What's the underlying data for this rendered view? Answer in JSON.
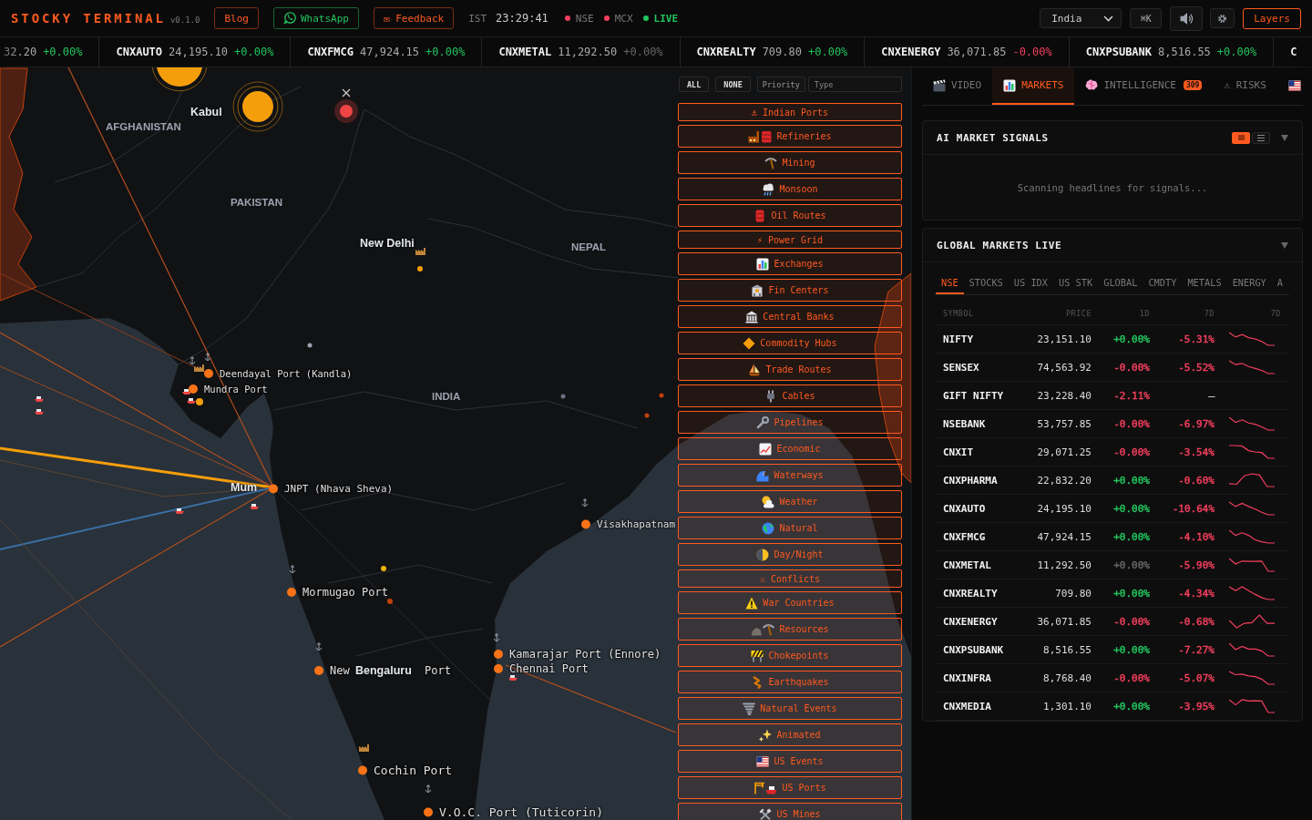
{
  "header": {
    "brand": "STOCKY TERMINAL",
    "version": "v0.1.0",
    "links": [
      {
        "label": "Blog",
        "kind": "plain"
      },
      {
        "label": "WhatsApp",
        "kind": "whatsapp"
      },
      {
        "label": "✉ Feedback",
        "kind": "plain"
      }
    ],
    "timezone": "IST",
    "time": "23:29:41",
    "status": [
      {
        "label": "NSE",
        "kind": "market",
        "color": "#f43f5e"
      },
      {
        "label": "MCX",
        "kind": "market",
        "color": "#f43f5e"
      },
      {
        "label": "LIVE",
        "kind": "live",
        "color": "#22c55e"
      }
    ],
    "region": "India",
    "shortcut": "⌘K",
    "layers_button": "Layers"
  },
  "ticker": [
    {
      "price": "32.20",
      "change": "+0.00%",
      "color": "#22c55e"
    },
    {
      "symbol": "CNXAUTO",
      "price": "24,195.10",
      "change": "+0.00%",
      "color": "#22c55e"
    },
    {
      "symbol": "CNXFMCG",
      "price": "47,924.15",
      "change": "+0.00%",
      "color": "#22c55e"
    },
    {
      "symbol": "CNXMETAL",
      "price": "11,292.50",
      "change": "+0.00%",
      "color": "#666666"
    },
    {
      "symbol": "CNXREALTY",
      "price": "709.80",
      "change": "+0.00%",
      "color": "#22c55e"
    },
    {
      "symbol": "CNXENERGY",
      "price": "36,071.85",
      "change": "-0.00%",
      "color": "#f43f5e"
    },
    {
      "symbol": "CNXPSUBANK",
      "price": "8,516.55",
      "change": "+0.00%",
      "color": "#22c55e"
    },
    {
      "symbol": "C"
    }
  ],
  "map": {
    "labels": [
      {
        "text": "AFGHANISTAN",
        "kind": "country"
      },
      {
        "text": "Kabul",
        "kind": "city"
      },
      {
        "text": "PAKISTAN",
        "kind": "country"
      },
      {
        "text": "New Delhi",
        "kind": "city"
      },
      {
        "text": "NEPAL",
        "kind": "country"
      },
      {
        "text": "INDIA",
        "kind": "country"
      },
      {
        "text": "Deendayal Port (Kandla)",
        "kind": "port"
      },
      {
        "text": "Mundra Port",
        "kind": "port"
      },
      {
        "text": "Mum",
        "kind": "city"
      },
      {
        "text": "JNPT (Nhava Sheva)",
        "kind": "port"
      },
      {
        "text": "Mormugao Port",
        "kind": "port"
      },
      {
        "text": "New",
        "kind": "port"
      },
      {
        "text": "Bengaluru",
        "kind": "city"
      },
      {
        "text": "Port",
        "kind": "text"
      },
      {
        "text": "Visakhapatnam",
        "kind": "port"
      },
      {
        "text": "Kamarajar Port (Ennore)",
        "kind": "port"
      },
      {
        "text": "Chennai Port",
        "kind": "port"
      },
      {
        "text": "Cochin Port",
        "kind": "port"
      },
      {
        "text": "V.O.C. Port (Tuticorin)",
        "kind": "port"
      }
    ]
  },
  "layer_panel": {
    "controls": [
      {
        "label": "ALL",
        "kind": "action"
      },
      {
        "label": "NONE",
        "kind": "action"
      },
      {
        "label": "Priority",
        "kind": "sort"
      }
    ],
    "type_filter": {
      "placeholder": "Type"
    },
    "layers": [
      {
        "label": "⚓ Indian Ports",
        "on": true
      },
      {
        "label": "Refineries",
        "on": true
      },
      {
        "label": "Mining",
        "on": true
      },
      {
        "label": "Monsoon",
        "on": true
      },
      {
        "label": "Oil Routes",
        "on": true
      },
      {
        "label": "⚡ Power Grid",
        "on": true
      },
      {
        "label": "Exchanges",
        "on": true
      },
      {
        "label": "Fin Centers",
        "on": true
      },
      {
        "label": "Central Banks",
        "on": true
      },
      {
        "label": "Commodity Hubs",
        "on": true
      },
      {
        "label": "Trade Routes",
        "on": true
      },
      {
        "label": "Cables",
        "on": true
      },
      {
        "label": "Pipelines",
        "on": true
      },
      {
        "label": "Economic",
        "on": true
      },
      {
        "label": "Waterways",
        "on": true
      },
      {
        "label": "Weather",
        "on": true
      },
      {
        "label": "Natural",
        "on": true
      },
      {
        "label": "Day/Night",
        "on": true
      },
      {
        "label": "⚔ Conflicts",
        "on": true
      },
      {
        "label": "War Countries",
        "on": true
      },
      {
        "label": "Resources",
        "on": true
      },
      {
        "label": "Chokepoints",
        "on": true
      },
      {
        "label": "Earthquakes",
        "on": true
      },
      {
        "label": "Natural Events",
        "on": true
      },
      {
        "label": "Animated",
        "on": true
      },
      {
        "label": "US Events",
        "on": true
      },
      {
        "label": "US Ports",
        "on": true
      },
      {
        "label": "US Mines",
        "on": true
      }
    ]
  },
  "sidebar": {
    "tabs": [
      {
        "label": "VIDEO",
        "selected": false
      },
      {
        "label": "MARKETS",
        "selected": true
      },
      {
        "label": "INTELLIGENCE",
        "selected": false,
        "badge": "309"
      },
      {
        "label": "⚠ RISKS",
        "selected": false
      },
      {
        "selected": false
      }
    ]
  },
  "signals": {
    "title": "AI MARKET SIGNALS",
    "view_modes": [
      {
        "selected": true
      },
      {
        "selected": false
      }
    ],
    "message": "Scanning headlines for signals..."
  },
  "markets": {
    "title": "GLOBAL MARKETS LIVE",
    "tabs": [
      {
        "label": "NSE",
        "selected": true
      },
      {
        "label": "STOCKS",
        "selected": false
      },
      {
        "label": "US IDX",
        "selected": false
      },
      {
        "label": "US STK",
        "selected": false
      },
      {
        "label": "GLOBAL",
        "selected": false
      },
      {
        "label": "CMDTY",
        "selected": false
      },
      {
        "label": "METALS",
        "selected": false
      },
      {
        "label": "ENERGY",
        "selected": false
      },
      {
        "label": "A",
        "selected": false
      }
    ],
    "columns": [
      "SYMBOL",
      "PRICE",
      "1D",
      "7D",
      "7D"
    ],
    "rows": [
      {
        "symbol": "NIFTY",
        "price": "23,151.10",
        "change_1d": {
          "text": "+0.00%",
          "color": "#22c55e"
        },
        "change_7d": {
          "text": "-5.31%",
          "color": "#f43f5e"
        },
        "sparkline": true
      },
      {
        "symbol": "SENSEX",
        "price": "74,563.92",
        "change_1d": {
          "text": "-0.00%",
          "color": "#f43f5e"
        },
        "change_7d": {
          "text": "-5.52%",
          "color": "#f43f5e"
        },
        "sparkline": true
      },
      {
        "symbol": "GIFT NIFTY",
        "price": "23,228.40",
        "change_1d": {
          "text": "-2.11%",
          "color": "#f43f5e"
        },
        "change_7d": {
          "text": "—"
        },
        "sparkline": false
      },
      {
        "symbol": "NSEBANK",
        "price": "53,757.85",
        "change_1d": {
          "text": "-0.00%",
          "color": "#f43f5e"
        },
        "change_7d": {
          "text": "-6.97%",
          "color": "#f43f5e"
        },
        "sparkline": true
      },
      {
        "symbol": "CNXIT",
        "price": "29,071.25",
        "change_1d": {
          "text": "-0.00%",
          "color": "#f43f5e"
        },
        "change_7d": {
          "text": "-3.54%",
          "color": "#f43f5e"
        },
        "sparkline": true
      },
      {
        "symbol": "CNXPHARMA",
        "price": "22,832.20",
        "change_1d": {
          "text": "+0.00%",
          "color": "#22c55e"
        },
        "change_7d": {
          "text": "-0.60%",
          "color": "#f43f5e"
        },
        "sparkline": true
      },
      {
        "symbol": "CNXAUTO",
        "price": "24,195.10",
        "change_1d": {
          "text": "+0.00%",
          "color": "#22c55e"
        },
        "change_7d": {
          "text": "-10.64%",
          "color": "#f43f5e"
        },
        "sparkline": true
      },
      {
        "symbol": "CNXFMCG",
        "price": "47,924.15",
        "change_1d": {
          "text": "+0.00%",
          "color": "#22c55e"
        },
        "change_7d": {
          "text": "-4.10%",
          "color": "#f43f5e"
        },
        "sparkline": true
      },
      {
        "symbol": "CNXMETAL",
        "price": "11,292.50",
        "change_1d": {
          "text": "+0.00%",
          "color": "#666666"
        },
        "change_7d": {
          "text": "-5.90%",
          "color": "#f43f5e"
        },
        "sparkline": true
      },
      {
        "symbol": "CNXREALTY",
        "price": "709.80",
        "change_1d": {
          "text": "+0.00%",
          "color": "#22c55e"
        },
        "change_7d": {
          "text": "-4.34%",
          "color": "#f43f5e"
        },
        "sparkline": true
      },
      {
        "symbol": "CNXENERGY",
        "price": "36,071.85",
        "change_1d": {
          "text": "-0.00%",
          "color": "#f43f5e"
        },
        "change_7d": {
          "text": "-0.68%",
          "color": "#f43f5e"
        },
        "sparkline": true
      },
      {
        "symbol": "CNXPSUBANK",
        "price": "8,516.55",
        "change_1d": {
          "text": "+0.00%",
          "color": "#22c55e"
        },
        "change_7d": {
          "text": "-7.27%",
          "color": "#f43f5e"
        },
        "sparkline": true
      },
      {
        "symbol": "CNXINFRA",
        "price": "8,768.40",
        "change_1d": {
          "text": "-0.00%",
          "color": "#f43f5e"
        },
        "change_7d": {
          "text": "-5.07%",
          "color": "#f43f5e"
        },
        "sparkline": true
      },
      {
        "symbol": "CNXMEDIA",
        "price": "1,301.10",
        "change_1d": {
          "text": "+0.00%",
          "color": "#22c55e"
        },
        "change_7d": {
          "text": "-3.95%",
          "color": "#f43f5e"
        },
        "sparkline": true
      }
    ]
  }
}
